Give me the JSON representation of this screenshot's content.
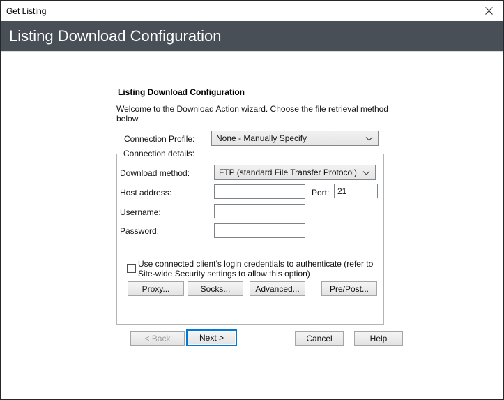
{
  "window": {
    "title": "Get Listing"
  },
  "banner": {
    "title": "Listing Download Configuration"
  },
  "wizard": {
    "heading": "Listing Download Configuration",
    "intro_lines": [
      "Welcome to the Download Action wizard. Choose the file retrieval method",
      "below."
    ],
    "connection_profile": {
      "label": "Connection Profile:",
      "value": "None - Manually Specify"
    },
    "details": {
      "group_label": "Connection details:",
      "download_method": {
        "label": "Download method:",
        "value": "FTP (standard File Transfer Protocol)"
      },
      "host_address": {
        "label": "Host address:",
        "value": ""
      },
      "port": {
        "label": "Port:",
        "value": "21"
      },
      "username": {
        "label": "Username:",
        "value": ""
      },
      "password": {
        "label": "Password:",
        "value": ""
      },
      "credentials_checkbox": {
        "checked": false,
        "label_lines": [
          "Use connected client’s login credentials to authenticate (refer to",
          "Site-wide Security settings to allow this option)"
        ]
      },
      "action_buttons": {
        "proxy": "Proxy...",
        "socks": "Socks...",
        "advanced": "Advanced...",
        "pre_post": "Pre/Post..."
      }
    },
    "nav": {
      "back": "< Back",
      "next": "Next >",
      "cancel": "Cancel",
      "help": "Help"
    }
  },
  "icons": {
    "close": "✕",
    "chevron_down": "⌄"
  },
  "colors": {
    "banner_bg": "#484f57",
    "banner_fg": "#ffffff",
    "focus_blue": "#0078d7"
  }
}
